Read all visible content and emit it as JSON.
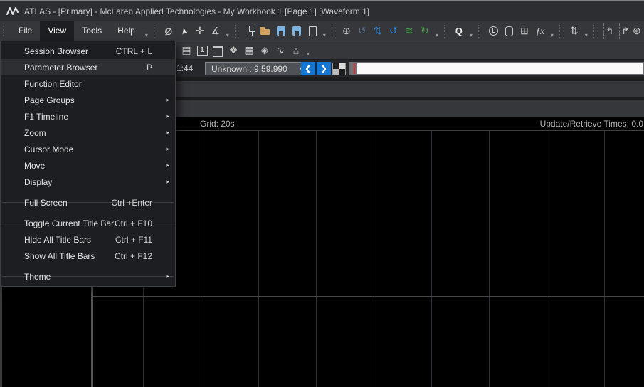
{
  "window": {
    "title": "ATLAS - [Primary] - McLaren Applied Technologies - My Workbook 1 [Page 1] [Waveform 1]"
  },
  "menubar": {
    "items": [
      {
        "label": "File",
        "cls": ""
      },
      {
        "label": "View",
        "cls": "active"
      },
      {
        "label": "Tools",
        "cls": ""
      },
      {
        "label": "Help",
        "cls": ""
      }
    ]
  },
  "toolbar_main": {
    "icons": [
      {
        "name": "overflow-arrow",
        "glyph": "▾",
        "cls": "dd",
        "inter": "true"
      },
      {
        "name": "group-separator",
        "glyph": "",
        "cls": "sep",
        "inter": "false"
      },
      {
        "name": "hide-annotations-icon",
        "glyph": "Ø",
        "color": "#c9c9c9",
        "cls": "",
        "inter": "true"
      },
      {
        "name": "pointer-cursor-icon",
        "glyph": "➤",
        "color": "#e8e8e8",
        "cls": "rot",
        "inter": "true"
      },
      {
        "name": "crosshair-cursor-icon",
        "glyph": "✛",
        "color": "#c9c9c9",
        "cls": "",
        "inter": "true"
      },
      {
        "name": "angle-cursor-icon",
        "glyph": "∡",
        "color": "#c9c9c9",
        "cls": "",
        "inter": "true"
      },
      {
        "name": "overflow-arrow",
        "glyph": "▾",
        "cls": "dd",
        "inter": "true"
      },
      {
        "name": "group-separator",
        "glyph": "",
        "cls": "sep",
        "inter": "false"
      },
      {
        "name": "paste-page-icon",
        "glyph": "",
        "cls": "doc2",
        "inter": "true"
      },
      {
        "name": "open-folder-icon",
        "glyph": "",
        "cls": "folder",
        "inter": "true"
      },
      {
        "name": "save-icon",
        "glyph": "",
        "cls": "floppy",
        "inter": "true"
      },
      {
        "name": "save-all-icon",
        "glyph": "",
        "cls": "floppy",
        "inter": "true"
      },
      {
        "name": "new-document-icon",
        "glyph": "",
        "cls": "doc",
        "inter": "true"
      },
      {
        "name": "overflow-arrow",
        "glyph": "▾",
        "cls": "dd",
        "inter": "true"
      },
      {
        "name": "group-separator",
        "glyph": "",
        "cls": "sep",
        "inter": "false"
      },
      {
        "name": "zoom-in-icon",
        "glyph": "⊕",
        "color": "#d0d0d0",
        "cls": "",
        "inter": "true"
      },
      {
        "name": "undo-disabled-icon",
        "glyph": "↺",
        "color": "#5d6d8c",
        "cls": "",
        "inter": "true"
      },
      {
        "name": "swap-vertical-icon",
        "glyph": "⇅",
        "color": "#3d8edb",
        "cls": "",
        "inter": "true"
      },
      {
        "name": "undo-icon",
        "glyph": "↺",
        "color": "#3d8edb",
        "cls": "",
        "inter": "true"
      },
      {
        "name": "smoothing-waves-icon",
        "glyph": "≋",
        "color": "#4aa44a",
        "cls": "",
        "inter": "true"
      },
      {
        "name": "redo-icon",
        "glyph": "↻",
        "color": "#4aa44a",
        "cls": "",
        "inter": "true"
      },
      {
        "name": "overflow-arrow",
        "glyph": "▾",
        "cls": "dd",
        "inter": "true"
      },
      {
        "name": "group-separator",
        "glyph": "",
        "cls": "sep",
        "inter": "false"
      },
      {
        "name": "query-icon",
        "glyph": "Q",
        "color": "#e8e8e8",
        "cls": "bold",
        "inter": "true"
      },
      {
        "name": "overflow-arrow",
        "glyph": "▾",
        "cls": "dd",
        "inter": "true"
      },
      {
        "name": "group-separator",
        "glyph": "",
        "cls": "sep",
        "inter": "false"
      },
      {
        "name": "alarm-clock-icon",
        "glyph": "",
        "cls": "clock",
        "inter": "true"
      },
      {
        "name": "database-icon",
        "glyph": "",
        "cls": "cyl",
        "inter": "true"
      },
      {
        "name": "report-table-icon",
        "glyph": "⊞",
        "color": "#c9c9c9",
        "cls": "",
        "inter": "true"
      },
      {
        "name": "function-editor-icon",
        "glyph": "ƒx",
        "color": "#c9c9c9",
        "cls": "ital",
        "inter": "true"
      },
      {
        "name": "overflow-arrow",
        "glyph": "▾",
        "cls": "dd",
        "inter": "true"
      },
      {
        "name": "group-separator",
        "glyph": "",
        "cls": "sep",
        "inter": "false"
      },
      {
        "name": "sort-updown-icon",
        "glyph": "⇅",
        "color": "#d8d8d8",
        "cls": "",
        "inter": "true"
      },
      {
        "name": "overflow-arrow",
        "glyph": "▾",
        "cls": "dd",
        "inter": "true"
      },
      {
        "name": "group-separator",
        "glyph": "",
        "cls": "sep",
        "inter": "false"
      },
      {
        "name": "jump-previous-icon",
        "glyph": "↰",
        "color": "#c9c9c9",
        "cls": "jmp",
        "inter": "true"
      },
      {
        "name": "jump-next-icon",
        "glyph": "↱",
        "color": "#c9c9c9",
        "cls": "jmp",
        "inter": "true"
      },
      {
        "name": "settings-gear-icon",
        "glyph": "⊛",
        "color": "#c9c9c9",
        "cls": "edge",
        "inter": "true"
      }
    ]
  },
  "toolbar_page": {
    "icons": [
      {
        "name": "clipboard-list-icon",
        "glyph": "▤",
        "color": "#c9c9c9",
        "cls": "",
        "inter": "true"
      },
      {
        "name": "single-page-icon",
        "glyph": "1",
        "color": "#c9c9c9",
        "cls": "boxed1",
        "inter": "true"
      },
      {
        "name": "calendar-icon",
        "glyph": "",
        "cls": "cal",
        "inter": "true"
      },
      {
        "name": "move-points-icon",
        "glyph": "❖",
        "color": "#c9c9c9",
        "cls": "",
        "inter": "true"
      },
      {
        "name": "data-grid-icon",
        "glyph": "▦",
        "color": "#c9c9c9",
        "cls": "",
        "inter": "true"
      },
      {
        "name": "gauge-icon",
        "glyph": "◈",
        "color": "#c9c9c9",
        "cls": "",
        "inter": "true"
      },
      {
        "name": "line-chart-icon",
        "glyph": "∿",
        "color": "#c9c9c9",
        "cls": "",
        "inter": "true"
      },
      {
        "name": "home-icon",
        "glyph": "⌂",
        "color": "#c9c9c9",
        "cls": "",
        "inter": "true"
      },
      {
        "name": "overflow-arrow",
        "glyph": "▾",
        "cls": "dd",
        "inter": "true"
      }
    ]
  },
  "timeline": {
    "elapsed": "1:44",
    "session_label": "Unknown : 9:59.990",
    "dropdown_arrow": "▾",
    "prev_button": "❮",
    "next_button": "❯",
    "cursor_color": "#dd2f2f",
    "accent_blue": "#1577d4"
  },
  "view_menu": {
    "items": [
      {
        "label": "Session Browser",
        "shortcut": "CTRL + L",
        "arrow": "",
        "cls": "",
        "inter": "true"
      },
      {
        "label": "Parameter Browser",
        "shortcut": "P",
        "arrow": "",
        "cls": "sel",
        "inter": "true"
      },
      {
        "label": "Function Editor",
        "shortcut": "",
        "arrow": "",
        "cls": "",
        "inter": "true"
      },
      {
        "label": "Page Groups",
        "shortcut": "",
        "arrow": "▸",
        "cls": "",
        "inter": "true"
      },
      {
        "label": "F1 Timeline",
        "shortcut": "",
        "arrow": "▸",
        "cls": "",
        "inter": "true"
      },
      {
        "label": "Zoom",
        "shortcut": "",
        "arrow": "▸",
        "cls": "",
        "inter": "true"
      },
      {
        "label": "Cursor Mode",
        "shortcut": "",
        "arrow": "▸",
        "cls": "",
        "inter": "true"
      },
      {
        "label": "Move",
        "shortcut": "",
        "arrow": "▸",
        "cls": "",
        "inter": "true"
      },
      {
        "label": "Display",
        "shortcut": "",
        "arrow": "▸",
        "cls": "",
        "inter": "true"
      },
      {
        "label": "",
        "shortcut": "",
        "arrow": "",
        "cls": "sep",
        "inter": "false"
      },
      {
        "label": "Full Screen",
        "shortcut": "Ctrl +Enter",
        "arrow": "",
        "cls": "",
        "inter": "true"
      },
      {
        "label": "",
        "shortcut": "",
        "arrow": "",
        "cls": "sep",
        "inter": "false"
      },
      {
        "label": "Toggle Current Title Bar",
        "shortcut": "Ctrl + F10",
        "arrow": "",
        "cls": "",
        "inter": "true"
      },
      {
        "label": "Hide All Title Bars",
        "shortcut": "Ctrl + F11",
        "arrow": "",
        "cls": "",
        "inter": "true"
      },
      {
        "label": "Show All Title Bars",
        "shortcut": "Ctrl + F12",
        "arrow": "",
        "cls": "",
        "inter": "true"
      },
      {
        "label": "",
        "shortcut": "",
        "arrow": "",
        "cls": "sep",
        "inter": "false"
      },
      {
        "label": "Theme",
        "shortcut": "",
        "arrow": "▸",
        "cls": "",
        "inter": "true"
      }
    ]
  },
  "waveform": {
    "grid_label": "Grid: 20s",
    "update_label": "Update/Retrieve Times: 0.0",
    "grid": {
      "vlines": [
        "201px",
        "282px",
        "363px",
        "444px",
        "525px",
        "606px",
        "687px",
        "768px",
        "849px"
      ]
    }
  }
}
